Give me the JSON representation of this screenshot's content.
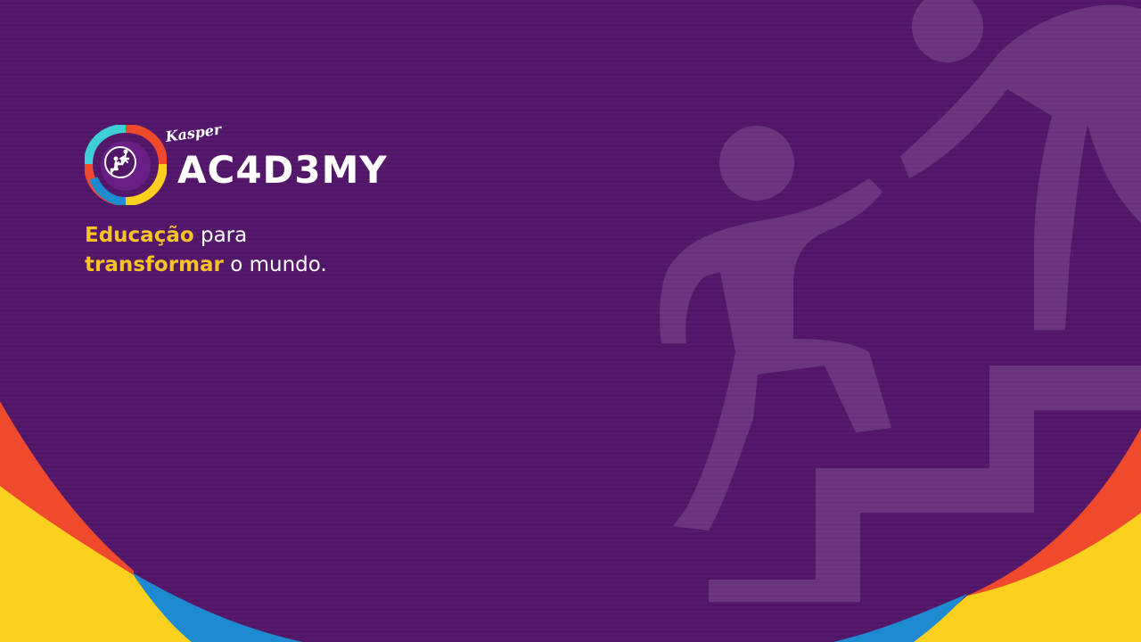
{
  "brand": {
    "script": "Kasper",
    "wordmark": "AC4D3MY"
  },
  "tagline": {
    "line1_highlight": "Educação",
    "line1_rest": " para",
    "line2_highlight": "transformar",
    "line2_rest": " o mundo."
  },
  "colors": {
    "background": "#521669",
    "highlight": "#f6c325",
    "red": "#f04a2e",
    "yellow": "#fcd01e",
    "blue": "#1e8bd0",
    "cyan": "#3fd0d6"
  }
}
